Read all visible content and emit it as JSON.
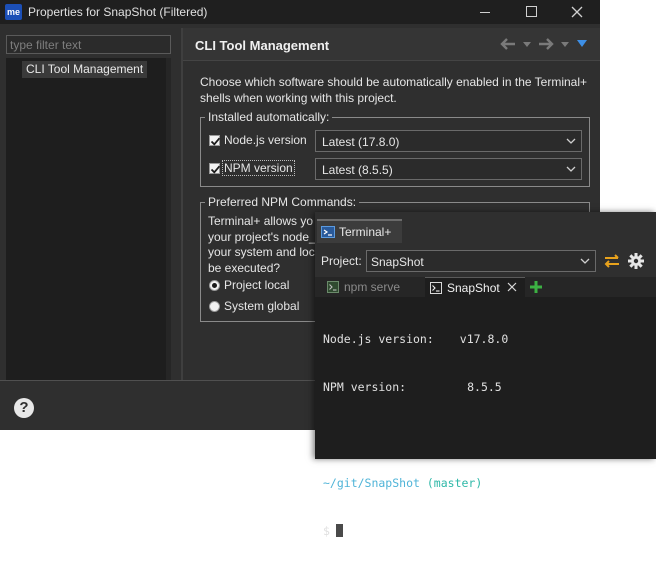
{
  "dialog": {
    "app_icon_text": "me",
    "title": "Properties for SnapShot (Filtered)",
    "filter_placeholder": "type filter text",
    "tree_items": [
      "CLI Tool Management"
    ],
    "page_title": "CLI Tool Management",
    "description": "Choose which software should be automatically enabled in the Terminal+ shells when working with this project.",
    "installed_group": {
      "title": "Installed automatically:",
      "items": [
        {
          "label": "Node.js version",
          "checked": true,
          "value": "Latest (17.8.0)"
        },
        {
          "label": "NPM version",
          "checked": true,
          "value": "Latest (8.5.5)"
        }
      ]
    },
    "npm_group": {
      "title": "Preferred NPM Commands:",
      "description_lines": [
        "Terminal+ allows yo",
        "your project's node_",
        "your system and loc",
        "be executed?"
      ],
      "options": [
        {
          "label": "Project local",
          "selected": true
        },
        {
          "label": "System global",
          "selected": false
        }
      ]
    },
    "help_label": "?"
  },
  "terminal": {
    "view_tab": "Terminal+",
    "project_label": "Project:",
    "project_value": "SnapShot",
    "sessions": [
      {
        "label": "npm serve",
        "active": false
      },
      {
        "label": "SnapShot",
        "active": true
      }
    ],
    "output": [
      {
        "key": "Node.js version:",
        "value": "v17.8.0"
      },
      {
        "key": "NPM version:",
        "value": "8.5.5"
      }
    ],
    "cwd": "~/git/SnapShot",
    "branch": "(master)",
    "prompt": "$"
  },
  "colors": {
    "accent_blue": "#3d8fe6",
    "sync_orange": "#e8a21c",
    "add_green": "#3cb043",
    "cwd_blue": "#4fb4d8",
    "branch_teal": "#2fb8a8"
  }
}
